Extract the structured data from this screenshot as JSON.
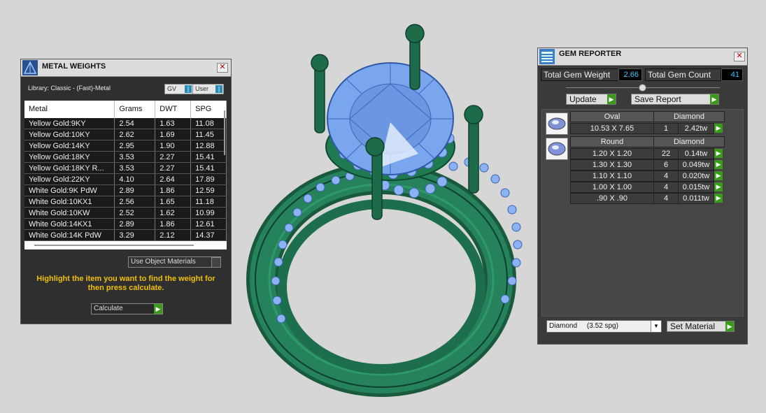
{
  "metal_weights": {
    "title": "METAL WEIGHTS",
    "close": "✕",
    "library": "Library: Classic - (Fast)-Metal",
    "gv_label": "GV",
    "user_label": "User",
    "columns": [
      "Metal",
      "Grams",
      "DWT",
      "SPG"
    ],
    "rows": [
      [
        "Yellow Gold:9KY",
        "2.54",
        "1.63",
        "11.08"
      ],
      [
        "Yellow Gold:10KY",
        "2.62",
        "1.69",
        "11.45"
      ],
      [
        "Yellow Gold:14KY",
        "2.95",
        "1.90",
        "12.88"
      ],
      [
        "Yellow Gold:18KY",
        "3.53",
        "2.27",
        "15.41"
      ],
      [
        "Yellow Gold:18KY R...",
        "3.53",
        "2.27",
        "15.41"
      ],
      [
        "Yellow Gold:22KY",
        "4.10",
        "2.64",
        "17.89"
      ],
      [
        "White Gold:9K PdW",
        "2.89",
        "1.86",
        "12.59"
      ],
      [
        "White Gold:10KX1",
        "2.56",
        "1.65",
        "11.18"
      ],
      [
        "White Gold:10KW",
        "2.52",
        "1.62",
        "10.99"
      ],
      [
        "White Gold:14KX1",
        "2.89",
        "1.86",
        "12.61"
      ],
      [
        "White Gold:14K PdW",
        "3.29",
        "2.12",
        "14.37"
      ]
    ],
    "use_object_materials": "Use Object Materials",
    "hint": "Highlight the item you want to find the weight for then press calculate.",
    "calculate": "Calculate"
  },
  "gem_reporter": {
    "title": "GEM REPORTER",
    "close": "✕",
    "total_weight_label": "Total Gem Weight",
    "total_weight": "2.66",
    "total_count_label": "Total Gem Count",
    "total_count": "41",
    "update": "Update",
    "save_report": "Save Report",
    "groups": [
      {
        "shape": "Oval",
        "material": "Diamond",
        "rows": [
          [
            "10.53 X 7.65",
            "1",
            "2.42tw"
          ]
        ]
      },
      {
        "shape": "Round",
        "material": "Diamond",
        "rows": [
          [
            "1.20 X 1.20",
            "22",
            "0.14tw"
          ],
          [
            "1.30 X 1.30",
            "6",
            "0.049tw"
          ],
          [
            "1.10 X 1.10",
            "4",
            "0.020tw"
          ],
          [
            "1.00 X 1.00",
            "4",
            "0.015tw"
          ],
          [
            ".90 X .90",
            "4",
            "0.011tw"
          ]
        ]
      }
    ],
    "material_select": "Diamond     (3.52 spg)",
    "set_material": "Set Material"
  },
  "colors": {
    "ring": "#1e6b4a",
    "gem": "#7aa6ee",
    "accent_go": "#3b9a1b",
    "value_text": "#3cc8ff",
    "hint_text": "#f0c000"
  }
}
